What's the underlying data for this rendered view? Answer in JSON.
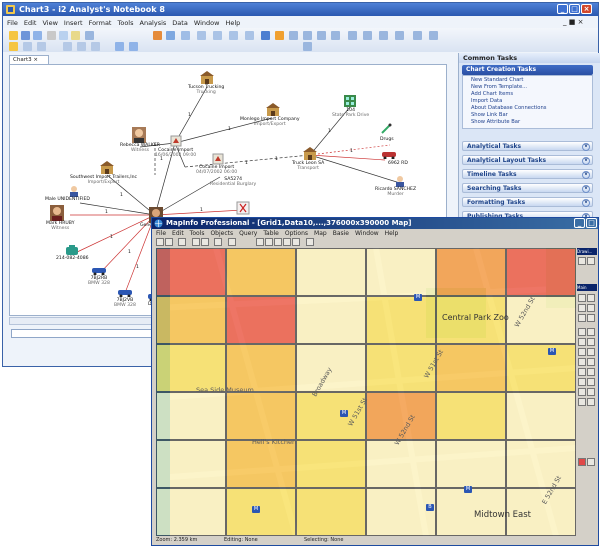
{
  "analyst_notebook": {
    "title": "Chart3 - i2 Analyst's Notebook 8",
    "menu": [
      "File",
      "Edit",
      "View",
      "Insert",
      "Format",
      "Tools",
      "Analysis",
      "Data",
      "Window",
      "Help"
    ],
    "doc_tab": "Chart3",
    "panel_title": "Common Tasks",
    "chart_creation": {
      "title": "Chart Creation Tasks",
      "items": [
        "New Standard Chart",
        "New From Template...",
        "Add Chart Items",
        "Import Data",
        "About Database Connections",
        "Show Link Bar",
        "Show Attribute Bar"
      ]
    },
    "task_groups": [
      "Analytical Tasks",
      "Analytical Layout Tasks",
      "Timeline Tasks",
      "Searching Tasks",
      "Formatting Tasks",
      "Publishing Tasks"
    ],
    "nodes": [
      {
        "id": "tucson",
        "label": "Tucson Trucking",
        "sub": "Trucking"
      },
      {
        "id": "monlego",
        "label": "Monlego Import Company",
        "sub": "Import/Export"
      },
      {
        "id": "wallace",
        "label": "Rebecca WALKER",
        "sub": "Witness"
      },
      {
        "id": "cocaine1",
        "label": "Cocaine Import",
        "sub": "16/06/2002 09:00"
      },
      {
        "id": "cocaine2",
        "label": "Cocaine Import",
        "sub": "04/07/2002 06:00"
      },
      {
        "id": "southwest",
        "label": "Southwest Import Trailers,Inc",
        "sub": "Import/Export"
      },
      {
        "id": "unident",
        "label": "Male UNIDENTIFIED",
        "sub": ""
      },
      {
        "id": "huley",
        "label": "Mark HRUBY",
        "sub": "Witness"
      },
      {
        "id": "gene",
        "label": "Gene HI",
        "sub": ""
      },
      {
        "id": "burglary",
        "label": "SA5274",
        "sub": "Residential Burglary"
      },
      {
        "id": "fruit",
        "label": "104",
        "sub": "State Park Drive"
      },
      {
        "id": "drugs",
        "label": "Drugs",
        "sub": ""
      },
      {
        "id": "truck_leon",
        "label": "Truck Leon SA",
        "sub": "Transport"
      },
      {
        "id": "car_right",
        "label": "6962 RD",
        "sub": ""
      },
      {
        "id": "sanchez",
        "label": "Ricardo SANCHEZ",
        "sub": "Murder"
      },
      {
        "id": "phone",
        "label": "214-082-4086",
        "sub": ""
      },
      {
        "id": "car1",
        "label": "7BJ2RB",
        "sub": "BMW 328"
      },
      {
        "id": "car2",
        "label": "7BJ2VB",
        "sub": "BMW 328"
      },
      {
        "id": "car3",
        "label": "DO-9967",
        "sub": ""
      }
    ],
    "link_labels": [
      "1",
      "1",
      "1",
      "1",
      "1",
      "1",
      "1",
      "1",
      "1",
      "1",
      "1",
      "1",
      "1",
      "1"
    ]
  },
  "mapinfo": {
    "title": "MapInfo Professional - [Grid1,Data10,...,376000x390000 Map]",
    "menu": [
      "File",
      "Edit",
      "Tools",
      "Objects",
      "Query",
      "Table",
      "Options",
      "Map",
      "Basie",
      "Window",
      "Help"
    ],
    "status": {
      "zoom": "Zoom: 2.359 km",
      "editing": "Editing: None",
      "selecting": "Selecting: None"
    },
    "tool_panels": [
      "Drawi...",
      "Main"
    ],
    "streets": [
      "W 51st St",
      "W 52nd St",
      "W 51st St",
      "W 52nd St",
      "Central Park Zoo",
      "Midtown East",
      "Broadway",
      "Sea Side Museum",
      "Hell's Kitchen",
      "E 52nd St"
    ],
    "grid_colors": {
      "red": "#e8412a",
      "orange": "#f28a26",
      "amber": "#f6b82f",
      "yellow": "#f7dc4b",
      "pale": "#fbf0b5"
    }
  }
}
